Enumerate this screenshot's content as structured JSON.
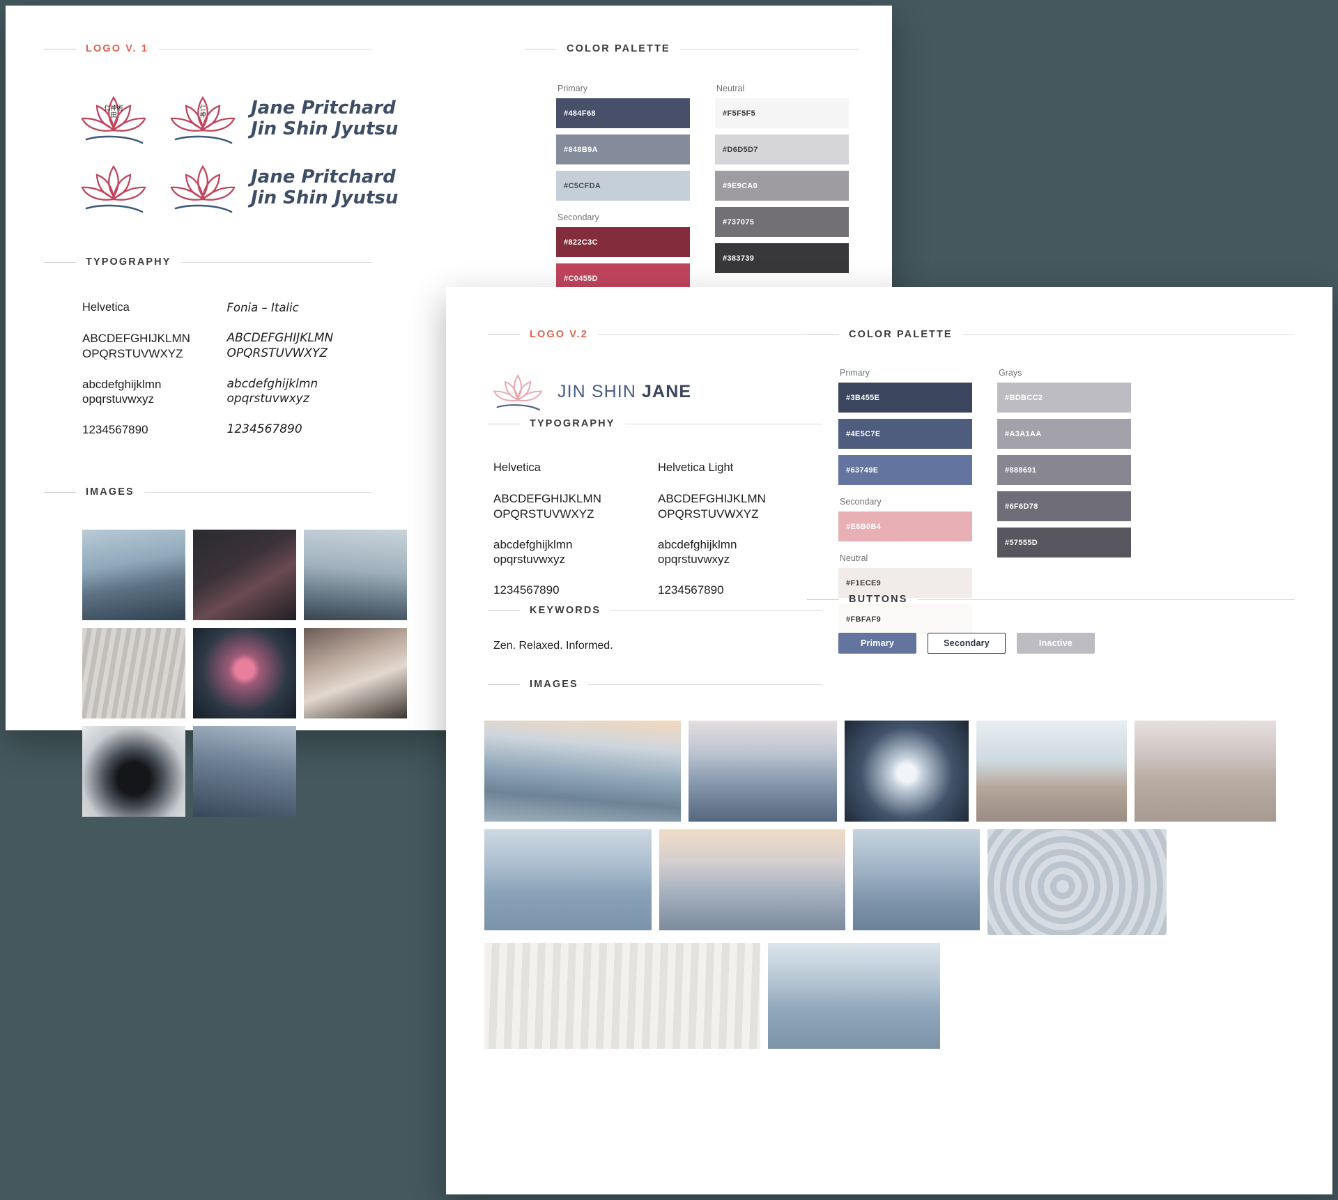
{
  "card1": {
    "logo_section": {
      "title": "LOGO V. 1",
      "wordmark_line1": "Jane Pritchard",
      "wordmark_line2": "Jin Shin Jyutsu",
      "kanji": "仁神術"
    },
    "typography": {
      "title": "TYPOGRAPHY",
      "fonts": [
        {
          "name": "Helvetica",
          "uppercase_line1": "ABCDEFGHIJKLMN",
          "uppercase_line2": "OPQRSTUVWXYZ",
          "lowercase_line1": "abcdefghijklmn",
          "lowercase_line2": "opqrstuvwxyz",
          "numerals": "1234567890"
        },
        {
          "name": "Fonia – Italic",
          "uppercase_line1": "ABCDEFGHIJKLMN",
          "uppercase_line2": "OPQRSTUVWXYZ",
          "lowercase_line1": "abcdefghijklmn",
          "lowercase_line2": "opqrstuvwxyz",
          "numerals": "1234567890"
        }
      ]
    },
    "color_palette": {
      "title": "COLOR PALETTE",
      "groups": [
        {
          "label": "Primary",
          "swatches": [
            {
              "hex": "#484F68",
              "text_color": "#ffffff"
            },
            {
              "hex": "#848B9A",
              "text_color": "#ffffff"
            },
            {
              "hex": "#C5CFDA",
              "text_color": "#4a4a4a"
            }
          ]
        },
        {
          "label": "Secondary",
          "swatches": [
            {
              "hex": "#822C3C",
              "text_color": "#ffffff"
            },
            {
              "hex": "#C0455D",
              "text_color": "#ffffff"
            }
          ]
        },
        {
          "label": "Neutral",
          "swatches": [
            {
              "hex": "#F5F5F5",
              "text_color": "#3a3a3a"
            },
            {
              "hex": "#D6D5D7",
              "text_color": "#3a3a3a"
            },
            {
              "hex": "#9E9CA0",
              "text_color": "#ffffff"
            },
            {
              "hex": "#737075",
              "text_color": "#ffffff"
            },
            {
              "hex": "#383739",
              "text_color": "#ffffff"
            }
          ]
        }
      ]
    },
    "images": {
      "title": "IMAGES",
      "tiles": [
        "water-reflection",
        "cherry-blossom",
        "water-droplet",
        "raked-sand",
        "pink-lotus",
        "couple-meditating",
        "pouring-tea-bowl",
        "dusk-water"
      ]
    }
  },
  "card2": {
    "logo_section": {
      "title": "LOGO V.2",
      "wordmark_light": "JIN SHIN ",
      "wordmark_bold": "JANE"
    },
    "typography": {
      "title": "TYPOGRAPHY",
      "fonts": [
        {
          "name": "Helvetica",
          "uppercase_line1": "ABCDEFGHIJKLMN",
          "uppercase_line2": "OPQRSTUVWXYZ",
          "lowercase_line1": "abcdefghijklmn",
          "lowercase_line2": "opqrstuvwxyz",
          "numerals": "1234567890"
        },
        {
          "name": "Helvetica Light",
          "uppercase_line1": "ABCDEFGHIJKLMN",
          "uppercase_line2": "OPQRSTUVWXYZ",
          "lowercase_line1": "abcdefghijklmn",
          "lowercase_line2": "opqrstuvwxyz",
          "numerals": "1234567890"
        }
      ]
    },
    "keywords": {
      "title": "KEYWORDS",
      "text": "Zen. Relaxed. Informed."
    },
    "color_palette": {
      "title": "COLOR PALETTE",
      "groups": [
        {
          "label": "Primary",
          "swatches": [
            {
              "hex": "#3B455E",
              "text_color": "#ffffff"
            },
            {
              "hex": "#4E5C7E",
              "text_color": "#ffffff"
            },
            {
              "hex": "#63749E",
              "text_color": "#ffffff"
            }
          ]
        },
        {
          "label": "Secondary",
          "swatches": [
            {
              "hex": "#E8B0B4",
              "text_color": "#ffffff"
            }
          ]
        },
        {
          "label": "Neutral",
          "swatches": [
            {
              "hex": "#F1ECE9",
              "text_color": "#3a3a3a"
            },
            {
              "hex": "#FBFAF9",
              "text_color": "#3a3a3a"
            }
          ]
        },
        {
          "label": "Grays",
          "swatches": [
            {
              "hex": "#BDBCC2",
              "text_color": "#ffffff"
            },
            {
              "hex": "#A3A1AA",
              "text_color": "#ffffff"
            },
            {
              "hex": "#888691",
              "text_color": "#ffffff"
            },
            {
              "hex": "#6F6D78",
              "text_color": "#ffffff"
            },
            {
              "hex": "#57555D",
              "text_color": "#ffffff"
            }
          ]
        }
      ]
    },
    "buttons": {
      "title": "BUTTONS",
      "items": [
        {
          "label": "Primary",
          "state": "primary"
        },
        {
          "label": "Secondary",
          "state": "secondary"
        },
        {
          "label": "Inactive",
          "state": "inactive"
        }
      ]
    },
    "images": {
      "title": "IMAGES",
      "tiles": [
        "lone-tree-lake",
        "misty-mountains",
        "white-lotus-dark",
        "frangipani-stones",
        "beach-dune-grass",
        "calm-sea",
        "stepping-stones-sunset",
        "open-ocean",
        "zen-stone-ripples",
        "stacked-pebbles-sand",
        "foggy-seascape"
      ]
    }
  }
}
